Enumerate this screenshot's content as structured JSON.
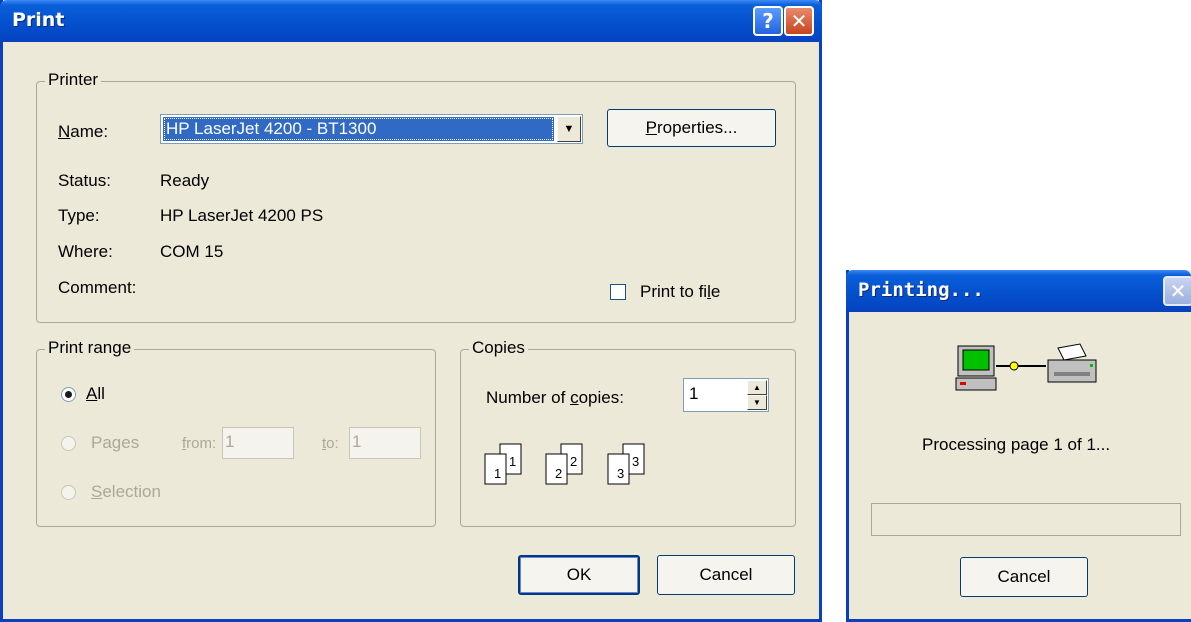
{
  "print_dialog": {
    "title": "Print",
    "help_symbol": "?",
    "close_symbol": "✕",
    "printer_group": {
      "legend": "Printer",
      "name_label": "Name:",
      "name_value": "HP LaserJet 4200 - BT1300",
      "properties_button": "Properties...",
      "status_label": "Status:",
      "status_value": "Ready",
      "type_label": "Type:",
      "type_value": "HP LaserJet 4200 PS",
      "where_label": "Where:",
      "where_value": "COM 15",
      "comment_label": "Comment:",
      "comment_value": "",
      "print_to_file_label": "Print to file",
      "print_to_file_checked": false
    },
    "print_range": {
      "legend": "Print range",
      "all_label": "All",
      "all_selected": true,
      "pages_label": "Pages",
      "from_label": "from:",
      "from_value": "1",
      "to_label": "to:",
      "to_value": "1",
      "selection_label": "Selection"
    },
    "copies": {
      "legend": "Copies",
      "number_label": "Number of copies:",
      "number_value": "1",
      "collate_pages": [
        "1",
        "2",
        "3"
      ]
    },
    "ok_button": "OK",
    "cancel_button": "Cancel"
  },
  "printing_dialog": {
    "title": "Printing...",
    "close_symbol": "✕",
    "message": "Processing page 1 of 1...",
    "progress_fraction": 0,
    "cancel_button": "Cancel"
  }
}
